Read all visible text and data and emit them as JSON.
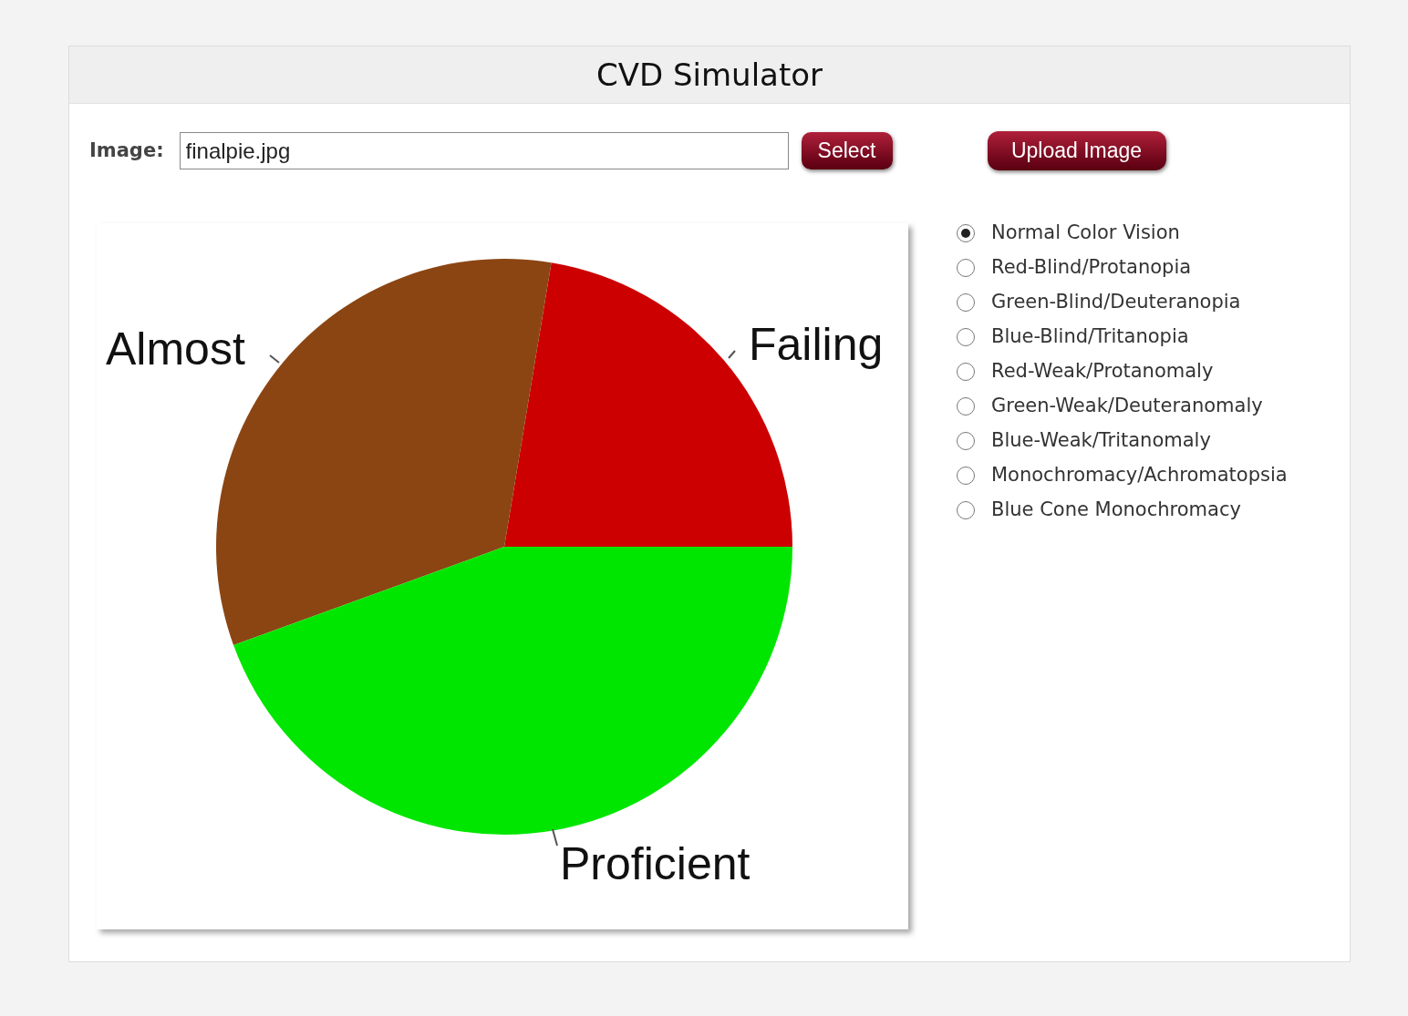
{
  "panel": {
    "title": "CVD Simulator"
  },
  "image_field": {
    "label": "Image:",
    "value": "finalpie.jpg"
  },
  "buttons": [
    {
      "label": "Select"
    },
    {
      "label": "Upload Image"
    }
  ],
  "preview": {
    "slices": [
      {
        "label": "Failing",
        "color": "#cc0000"
      },
      {
        "label": "Almost",
        "color": "#8b4513"
      },
      {
        "label": "Proficient",
        "color": "#00e600"
      }
    ]
  },
  "modes": [
    {
      "label": "Normal Color Vision",
      "selected": true
    },
    {
      "label": "Red-Blind/Protanopia",
      "selected": false
    },
    {
      "label": "Green-Blind/Deuteranopia",
      "selected": false
    },
    {
      "label": "Blue-Blind/Tritanopia",
      "selected": false
    },
    {
      "label": "Red-Weak/Protanomaly",
      "selected": false
    },
    {
      "label": "Green-Weak/Deuteranomaly",
      "selected": false
    },
    {
      "label": "Blue-Weak/Tritanomaly",
      "selected": false
    },
    {
      "label": "Monochromacy/Achromatopsia",
      "selected": false
    },
    {
      "label": "Blue Cone Monochromacy",
      "selected": false
    }
  ]
}
